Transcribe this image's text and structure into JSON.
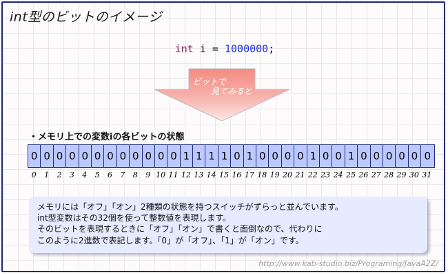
{
  "title": "int型のビットのイメージ",
  "code": {
    "keyword": "int",
    "var": " i = ",
    "value": "1000000",
    "end": ";"
  },
  "arrow": {
    "line1": "ビットで",
    "line2": "見てみると",
    "color": "#f4928a"
  },
  "section_title": "・メモリ上での変数iの各ビットの状態",
  "bits": [
    "0",
    "0",
    "0",
    "0",
    "0",
    "0",
    "0",
    "0",
    "0",
    "0",
    "0",
    "0",
    "1",
    "1",
    "1",
    "1",
    "0",
    "1",
    "0",
    "0",
    "0",
    "0",
    "1",
    "0",
    "0",
    "1",
    "0",
    "0",
    "0",
    "0",
    "0",
    "0"
  ],
  "indices": [
    "0",
    "1",
    "2",
    "3",
    "4",
    "5",
    "6",
    "7",
    "8",
    "9",
    "10",
    "11",
    "12",
    "13",
    "14",
    "15",
    "16",
    "17",
    "18",
    "19",
    "20",
    "21",
    "22",
    "23",
    "24",
    "25",
    "26",
    "27",
    "28",
    "29",
    "30",
    "31"
  ],
  "note": {
    "lines": [
      "メモリには「オフ」「オン」2種類の状態を持つスイッチがずらっと並んでいます。",
      "int型変数はその32個を使って整数値を表現します。",
      "そのビットを表現するときに「オフ」「オン」で書くと面倒なので、代わりに",
      "このように2進数で表記します。「0」が「オフ」、「1」が「オン」です。"
    ]
  },
  "footer": "http://www.kab-studio.biz/Programing/JavaA2Z/",
  "colors": {
    "bit_fill": "#bcc9ff",
    "border": "#1f2a78",
    "note_bg": "#e7ebff"
  }
}
